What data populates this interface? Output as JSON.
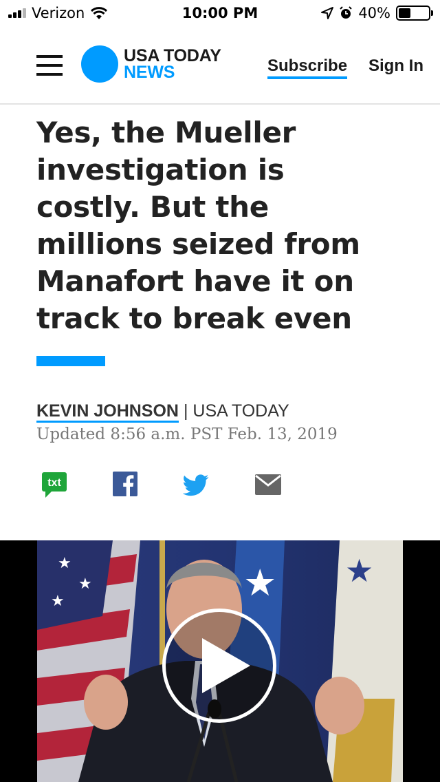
{
  "status_bar": {
    "carrier": "Verizon",
    "time": "10:00 PM",
    "battery": "40%",
    "battery_level": 0.4
  },
  "header": {
    "logo_top": "USA TODAY",
    "logo_bottom": "NEWS",
    "subscribe": "Subscribe",
    "sign_in": "Sign In",
    "accent_color": "#009bff"
  },
  "article": {
    "headline_lines": [
      "Yes, the Mueller",
      "investigation is",
      "costly. But the",
      "millions seized from",
      "Manafort have it on",
      "track to break even"
    ],
    "author": "KEVIN JOHNSON",
    "separator": "|",
    "publication": "USA TODAY",
    "updated": "Updated 8:56 a.m. PST Feb. 13, 2019"
  },
  "share": {
    "txt_label": "txt",
    "icons": [
      "text-message-icon",
      "facebook-icon",
      "twitter-icon",
      "email-icon"
    ]
  },
  "video": {
    "icon": "play-icon"
  }
}
